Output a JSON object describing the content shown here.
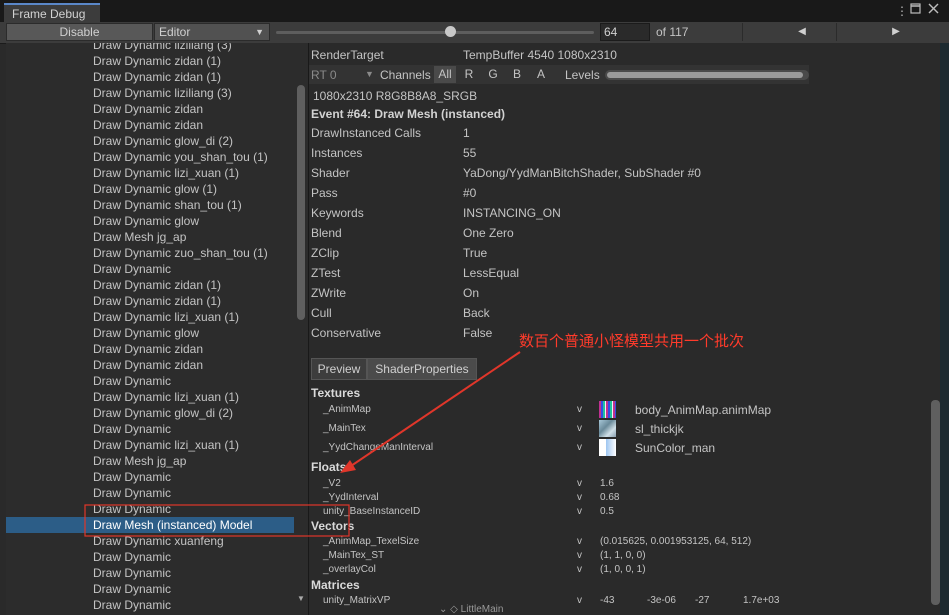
{
  "window": {
    "tab_title": "Frame Debug",
    "menu_icon": "kebab-icon",
    "maximize_icon": "maximize-icon",
    "close_icon": "close-icon"
  },
  "toolbar": {
    "disable_label": "Disable",
    "mode_value": "Editor",
    "frame_slider_value": 64,
    "frame_slider_max": 117,
    "frame_value": "64",
    "of_label": "of 117",
    "prev_icon": "◀",
    "next_icon": "▶"
  },
  "events": [
    "Draw Dynamic liziliang (3)",
    "Draw Dynamic zidan (1)",
    "Draw Dynamic zidan (1)",
    "Draw Dynamic liziliang (3)",
    "Draw Dynamic zidan",
    "Draw Dynamic zidan",
    "Draw Dynamic glow_di (2)",
    "Draw Dynamic you_shan_tou (1)",
    "Draw Dynamic lizi_xuan (1)",
    "Draw Dynamic glow (1)",
    "Draw Dynamic shan_tou (1)",
    "Draw Dynamic glow",
    "Draw Mesh jg_ap",
    "Draw Dynamic zuo_shan_tou (1)",
    "Draw Dynamic",
    "Draw Dynamic zidan (1)",
    "Draw Dynamic zidan (1)",
    "Draw Dynamic lizi_xuan (1)",
    "Draw Dynamic glow",
    "Draw Dynamic zidan",
    "Draw Dynamic zidan",
    "Draw Dynamic",
    "Draw Dynamic lizi_xuan (1)",
    "Draw Dynamic glow_di (2)",
    "Draw Dynamic",
    "Draw Dynamic lizi_xuan (1)",
    "Draw Mesh jg_ap",
    "Draw Dynamic",
    "Draw Dynamic",
    "Draw Dynamic",
    "Draw Mesh (instanced) Model",
    "Draw Dynamic xuanfeng",
    "Draw Dynamic",
    "Draw Dynamic",
    "Draw Dynamic",
    "Draw Dynamic"
  ],
  "selected_event_index": 30,
  "details": {
    "render_target_label": "RenderTarget",
    "render_target_value": "TempBuffer 4540 1080x2310",
    "rt_select": "RT 0",
    "channels_label": "Channels",
    "channels": [
      "All",
      "R",
      "G",
      "B",
      "A"
    ],
    "levels_label": "Levels",
    "format": "1080x2310 R8G8B8A8_SRGB",
    "event_title": "Event #64: Draw Mesh (instanced)",
    "properties": [
      {
        "label": "DrawInstanced Calls",
        "value": "1"
      },
      {
        "label": "Instances",
        "value": "55"
      },
      {
        "label": "Shader",
        "value": "YaDong/YydManBitchShader, SubShader #0"
      },
      {
        "label": "Pass",
        "value": "#0"
      },
      {
        "label": "Keywords",
        "value": "INSTANCING_ON"
      },
      {
        "label": "Blend",
        "value": "One Zero"
      },
      {
        "label": "ZClip",
        "value": "True"
      },
      {
        "label": "ZTest",
        "value": "LessEqual"
      },
      {
        "label": "ZWrite",
        "value": "On"
      },
      {
        "label": "Cull",
        "value": "Back"
      },
      {
        "label": "Conservative",
        "value": "False"
      }
    ],
    "tabs": [
      "Preview",
      "ShaderProperties"
    ],
    "textures_header": "Textures",
    "textures": [
      {
        "name": "_AnimMap",
        "stage": "v",
        "value": "body_AnimMap.animMap"
      },
      {
        "name": "_MainTex",
        "stage": "v",
        "value": "sl_thickjk"
      },
      {
        "name": "_YydChangeManInterval",
        "stage": "v",
        "value": "SunColor_man"
      }
    ],
    "floats_header": "Floats",
    "floats": [
      {
        "name": "_V2",
        "stage": "v",
        "value": "1.6"
      },
      {
        "name": "_YydInterval",
        "stage": "v",
        "value": "0.68"
      },
      {
        "name": "unity_BaseInstanceID",
        "stage": "v",
        "value": "0.5"
      }
    ],
    "vectors_header": "Vectors",
    "vectors": [
      {
        "name": "_AnimMap_TexelSize",
        "stage": "v",
        "value": "(0.015625, 0.001953125, 64, 512)"
      },
      {
        "name": "_MainTex_ST",
        "stage": "v",
        "value": "(1, 1, 0, 0)"
      },
      {
        "name": "_overlayCol",
        "stage": "v",
        "value": "(1, 0, 0, 1)"
      }
    ],
    "matrices_header": "Matrices",
    "matrices": [
      {
        "name": "unity_MatrixVP",
        "stage": "v",
        "values": [
          "-43",
          "-3e-06",
          "-27",
          "1.7e+03"
        ]
      }
    ],
    "bottom_partial": "LittleMain"
  },
  "annotation": {
    "text": "数百个普通小怪模型共用一个批次",
    "color": "#ff3b2b"
  },
  "colors": {
    "selection": "#2c5d87",
    "annotation_red": "#ff3b2b",
    "background": "#2a2a2a"
  }
}
